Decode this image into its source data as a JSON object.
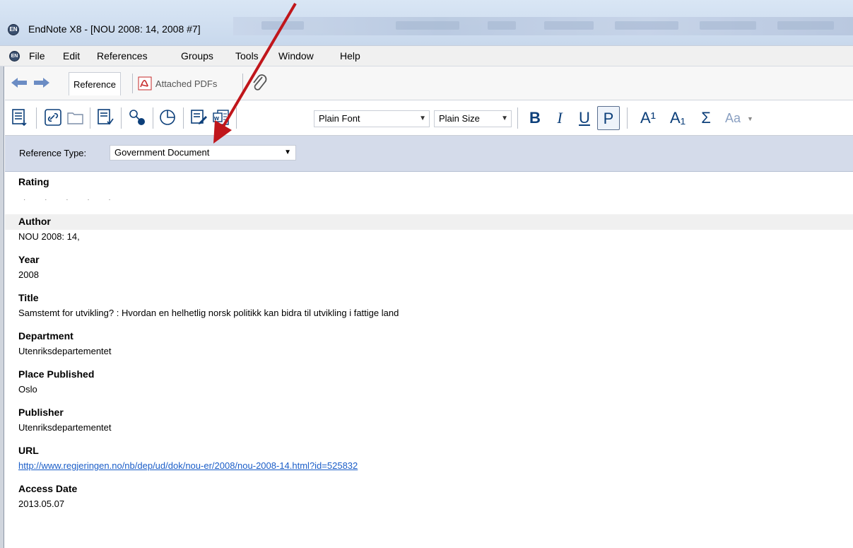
{
  "window": {
    "title": "EndNote X8 - [NOU 2008: 14, 2008 #7]",
    "app_icon_text": "EN"
  },
  "menu": {
    "items": [
      "File",
      "Edit",
      "References",
      "Groups",
      "Tools",
      "Window",
      "Help"
    ]
  },
  "tabs": {
    "reference": "Reference",
    "attached_pdfs": "Attached PDFs"
  },
  "toolbar": {
    "font_select": "Plain Font",
    "size_select": "Plain Size",
    "bold": "B",
    "italic": "I",
    "underline": "U",
    "plain": "P",
    "superscript": "A¹",
    "subscript": "A₁",
    "symbol": "Σ",
    "case": "Aa"
  },
  "reference_type": {
    "label": "Reference Type:",
    "value": "Government Document"
  },
  "fields": {
    "rating": {
      "label": "Rating",
      "value": "· · · · ·"
    },
    "author": {
      "label": "Author",
      "value": "NOU 2008: 14,"
    },
    "year": {
      "label": "Year",
      "value": "2008"
    },
    "title": {
      "label": "Title",
      "value": "Samstemt for utvikling? : Hvordan en helhetlig norsk politikk kan bidra til utvikling i fattige land"
    },
    "department": {
      "label": "Department",
      "value": "Utenriksdepartementet"
    },
    "place_published": {
      "label": "Place Published",
      "value": "Oslo"
    },
    "publisher": {
      "label": "Publisher",
      "value": "Utenriksdepartementet"
    },
    "url": {
      "label": "URL",
      "value": "http://www.regjeringen.no/nb/dep/ud/dok/nou-er/2008/nou-2008-14.html?id=525832"
    },
    "access_date": {
      "label": "Access Date",
      "value": "2013.05.07"
    }
  },
  "colors": {
    "accent_link": "#1a5dc8",
    "reftype_band": "#d4dbea",
    "annotation_arrow": "#c0161b"
  }
}
